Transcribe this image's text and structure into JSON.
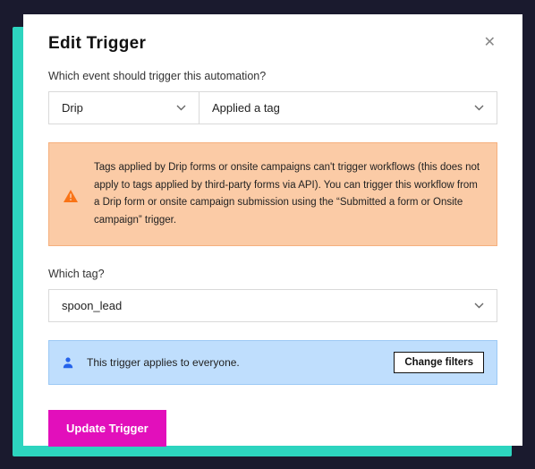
{
  "modal": {
    "title": "Edit Trigger",
    "event_label": "Which event should trigger this automation?",
    "provider": "Drip",
    "event": "Applied a tag",
    "warning_text": "Tags applied by Drip forms or onsite campaigns can't trigger workflows (this does not apply to tags applied by third-party forms via API). You can trigger this workflow from a Drip form or onsite campaign submission using the “Submitted a form or Onsite campaign” trigger.",
    "tag_label": "Which tag?",
    "tag_value": "spoon_lead",
    "filters_text": "This trigger applies to everyone.",
    "change_filters_label": "Change filters",
    "update_label": "Update Trigger"
  }
}
